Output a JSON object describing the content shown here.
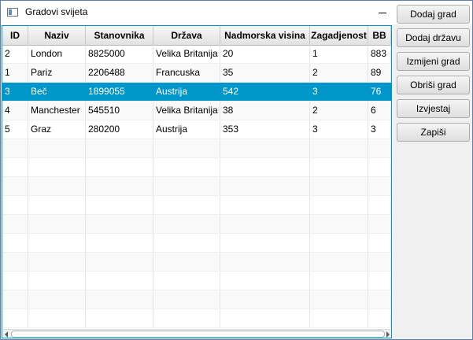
{
  "window": {
    "title": "Gradovi svijeta"
  },
  "table": {
    "columns": [
      "ID",
      "Naziv",
      "Stanovnika",
      "Država",
      "Nadmorska visina",
      "Zagadjenost",
      "BB"
    ],
    "rows": [
      [
        "2",
        "London",
        "8825000",
        "Velika Britanija",
        "20",
        "1",
        "883"
      ],
      [
        "1",
        "Pariz",
        "2206488",
        "Francuska",
        "35",
        "2",
        "89"
      ],
      [
        "3",
        "Beč",
        "1899055",
        "Austrija",
        "542",
        "3",
        "76"
      ],
      [
        "4",
        "Manchester",
        "545510",
        "Velika Britanija",
        "38",
        "2",
        "6"
      ],
      [
        "5",
        "Graz",
        "280200",
        "Austrija",
        "353",
        "3",
        "3"
      ]
    ],
    "selected_row": 2
  },
  "buttons": {
    "add_city": "Dodaj grad",
    "add_country": "Dodaj državu",
    "edit_city": "Izmijeni grad",
    "delete_city": "Obriši grad",
    "report": "Izvjestaj",
    "save": "Zapiši"
  },
  "colors": {
    "selection": "#0096c9",
    "border_focus": "#0096c9"
  }
}
